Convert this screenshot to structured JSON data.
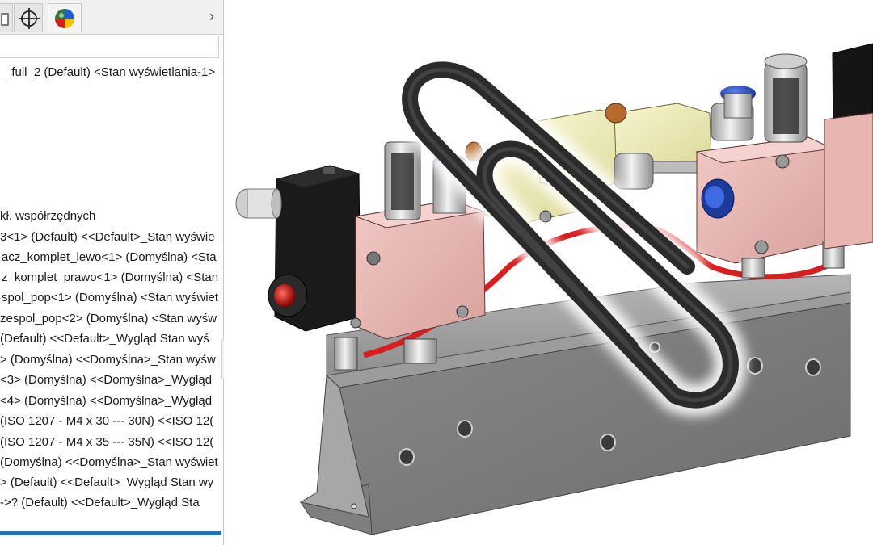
{
  "toolbar": {
    "tabs": [
      {
        "icon": "configuration-manager-icon"
      },
      {
        "icon": "dimxpert-manager-icon"
      },
      {
        "icon": "display-manager-icon"
      }
    ],
    "overflow_icon": "chevron-right-icon"
  },
  "filter": {
    "value": ""
  },
  "tree": {
    "items": [
      {
        "label": "_full_2 (Default) <Stan wyświetlania-1>"
      },
      {
        "label": "kł. współrzędnych"
      },
      {
        "label": "3<1> (Default) <<Default>_Stan wyświe"
      },
      {
        "label": "acz_komplet_lewo<1> (Domyślna) <Sta"
      },
      {
        "label": "z_komplet_prawo<1> (Domyślna) <Stan"
      },
      {
        "label": "spol_pop<1> (Domyślna) <Stan wyświet"
      },
      {
        "label": "zespol_pop<2> (Domyślna) <Stan wyśw"
      },
      {
        "label": "(Default) <<Default>_Wygląd Stan wyś"
      },
      {
        "label": "> (Domyślna) <<Domyślna>_Stan wyśw"
      },
      {
        "label": "<3> (Domyślna) <<Domyślna>_Wygląd"
      },
      {
        "label": "<4> (Domyślna) <<Domyślna>_Wygląd"
      },
      {
        "label": "(ISO 1207 - M4 x 30 --- 30N) <<ISO 12("
      },
      {
        "label": "(ISO 1207 - M4 x 35 --- 35N) <<ISO 12("
      },
      {
        "label": "(Domyślna) <<Domyślna>_Stan wyświet"
      },
      {
        "label": "> (Default) <<Default>_Wygląd Stan wy"
      },
      {
        "label": "->? (Default) <<Default>_Wygląd Sta"
      }
    ]
  },
  "colors": {
    "accent": "#2d6fb5",
    "bracket": "#7c7c7c",
    "manifold": "#e8b7b3",
    "valve_body": "#eeecb6",
    "solenoid": "#141414",
    "tube": "#d81e1e",
    "fitting_blue": "#1f3fb5"
  }
}
